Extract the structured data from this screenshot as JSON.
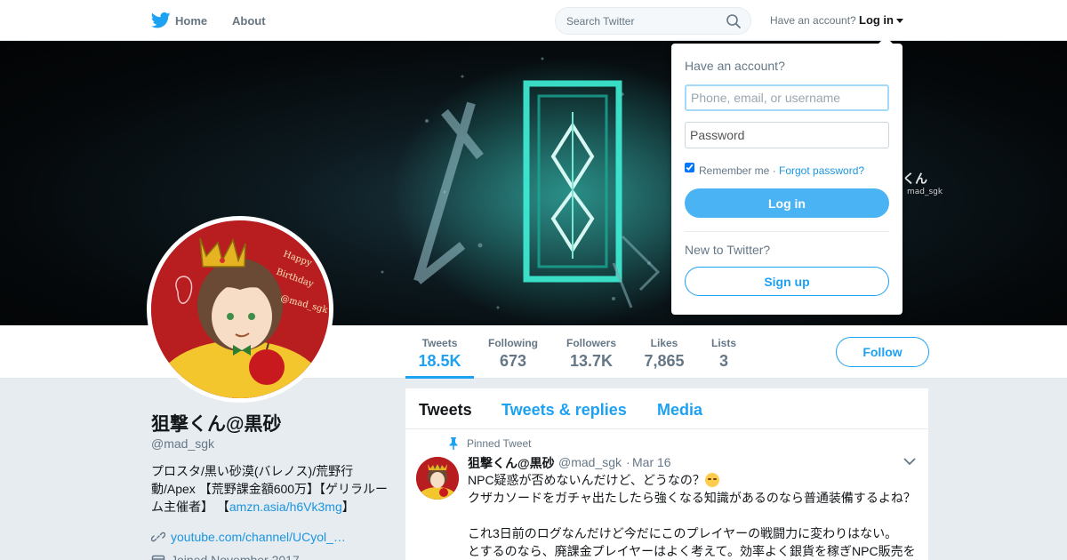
{
  "nav": {
    "home_label": "Home",
    "about_label": "About",
    "search_placeholder": "Search Twitter",
    "have_account": "Have an account?",
    "login_label": "Log in"
  },
  "brand": {
    "accent": "#1da1f2",
    "link": "#1b95e0"
  },
  "stats": [
    {
      "label": "Tweets",
      "value": "18.5K"
    },
    {
      "label": "Following",
      "value": "673"
    },
    {
      "label": "Followers",
      "value": "13.7K"
    },
    {
      "label": "Likes",
      "value": "7,865"
    },
    {
      "label": "Lists",
      "value": "3"
    }
  ],
  "follow_label": "Follow",
  "profile": {
    "name": "狙撃くん@黒砂",
    "handle": "@mad_sgk",
    "bio_text": "プロスタ/黒い砂漠(バレノス)/荒野行動/Apex 【荒野課金額600万】【ゲリラルーム主催者】 【",
    "bio_link": "amzn.asia/h6Vk3mg",
    "bio_end": "】",
    "website": "youtube.com/channel/UCyol_…",
    "joined": "Joined November 2017"
  },
  "timeline": {
    "tabs": [
      "Tweets",
      "Tweets & replies",
      "Media"
    ],
    "pinned_label": "Pinned Tweet",
    "tweet": {
      "name": "狙撃くん@黒砂",
      "handle": "@mad_sgk",
      "separator": "·",
      "date": "Mar 16",
      "line1": "NPC疑惑が否めないんだけど、どうなの？",
      "line2": "クザカソードをガチャ出たしたら強くなる知識があるのなら普通装備するよね？",
      "line3": "これ3日前のログなんだけど今だにこのプレイヤーの戦闘力に変わりはない。",
      "line4": "とするのなら、廃課金プレイヤーはよく考えて。効率よく銀貨を稼ぎNPC販売を"
    }
  },
  "login_dropdown": {
    "title": "Have an account?",
    "username_placeholder": "Phone, email, or username",
    "password_placeholder": "Password",
    "remember_label": "Remember me",
    "separator": "·",
    "forgot_label": "Forgot password?",
    "login_button": "Log in",
    "new_label": "New to Twitter?",
    "signup_button": "Sign up"
  }
}
